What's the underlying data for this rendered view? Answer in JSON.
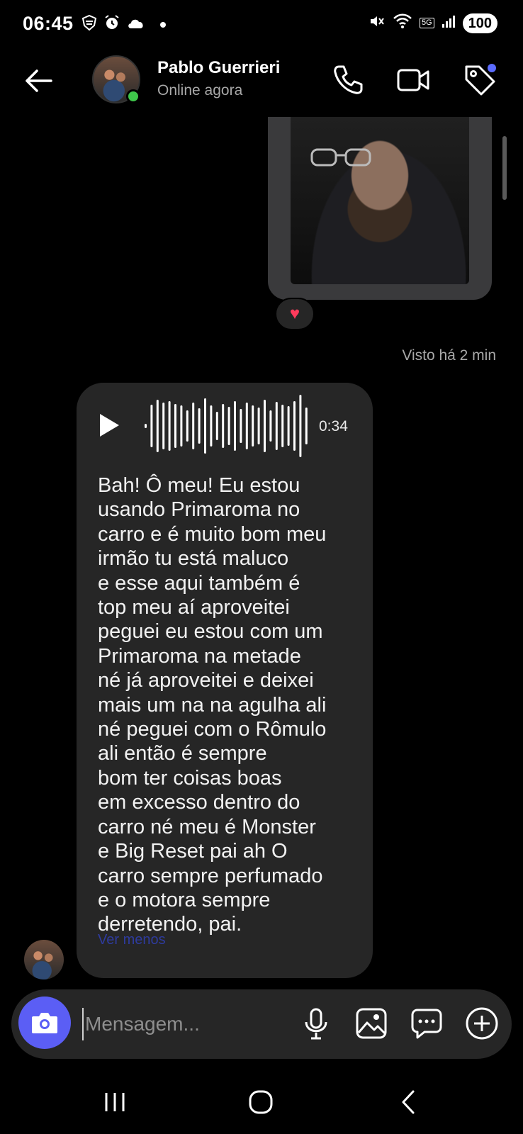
{
  "status_bar": {
    "time": "06:45",
    "network_badge": "5G",
    "battery": "100"
  },
  "header": {
    "contact_name": "Pablo Guerrieri",
    "contact_status": "Online agora",
    "online_color": "#3ec64a",
    "icons": [
      "back-arrow-icon",
      "phone-icon",
      "video-camera-icon",
      "tag-icon"
    ]
  },
  "messages": {
    "media_reaction": "♥",
    "seen_label": "Visto há 2 min",
    "voice": {
      "duration": "0:34",
      "transcript": "Bah! Ô meu! Eu estou\nusando Primaroma no\ncarro e é muito bom meu\nirmão tu está maluco\ne esse aqui também é\ntop meu aí aproveitei\npeguei eu estou com um\nPrimaroma na metade\nné já aproveitei e deixei\nmais um na na agulha ali\nné peguei com o Rômulo\nali então é sempre\nbom ter coisas boas\nem excesso dentro do\ncarro né meu é Monster\ne Big Reset pai ah O\ncarro sempre perfumado\ne o motora sempre\nderretendo, pai.",
      "see_less": "Ver menos"
    }
  },
  "composer": {
    "placeholder": "Mensagem...",
    "accent": "#5b5ef5"
  }
}
